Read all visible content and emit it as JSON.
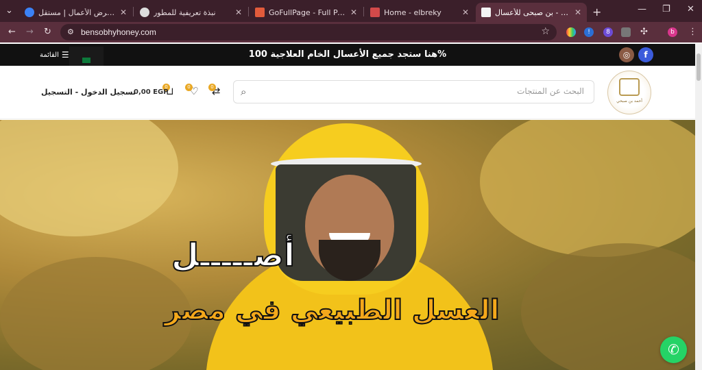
{
  "browser": {
    "tabs": [
      {
        "label": "إضافة معرض الأعمال | مستقل",
        "fav_color": "#3b82f6"
      },
      {
        "label": "نبذة تعريفية للمطور",
        "fav_color": "#dddddd"
      },
      {
        "label": "GoFullPage - Full Page Scre",
        "fav_color": "#e25b3b"
      },
      {
        "label": "Home - elbreky",
        "fav_color": "#d34a4a"
      },
      {
        "label": "الرئيسية - بن صبحى للأعسال",
        "fav_color": "#f4f4f4",
        "active": true
      }
    ],
    "url": "bensobhyhoney.com",
    "profile_letter": "b"
  },
  "topbar": {
    "message": "هنا ستجد جميع الأعسال الخام العلاجية 100%",
    "menu_label": "القائمة",
    "social": [
      {
        "icon": "facebook-icon",
        "glyph": "f",
        "color": "#3b5bdb"
      },
      {
        "icon": "instagram-icon",
        "glyph": "◎",
        "color": "#8a5a44"
      }
    ]
  },
  "header": {
    "search_placeholder": "البحث عن المنتجات",
    "login_label": "تسجيل الدخول - التسجيل",
    "cart_total": "0,00 EGP",
    "cart_count": "0",
    "wishlist_count": "0",
    "compare_count": "0",
    "logo_caption": "أحمد بن صبحي"
  },
  "hero": {
    "headline_top": "أصـــــل",
    "headline_bottom": "العسل الطبيعي في مصر"
  }
}
